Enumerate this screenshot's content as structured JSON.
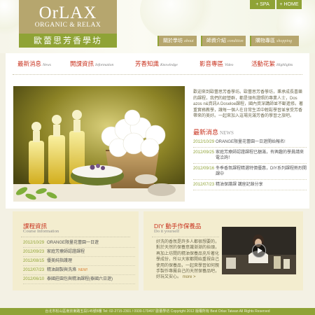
{
  "brand": {
    "logo_text": "OrLAX",
    "tagline": "ORGANIC & RELAX",
    "chinese_name": "歐蕾思芳香學坊"
  },
  "top_links": [
    {
      "label": "+ SPA"
    },
    {
      "label": "+ HOME"
    }
  ],
  "nav": [
    {
      "label": "關於學坊",
      "en": "about"
    },
    {
      "label": "師資介紹",
      "en": "condition"
    },
    {
      "label": "購物專區",
      "en": "shopping"
    }
  ],
  "tabs": [
    {
      "label": "最新消息",
      "en": "News"
    },
    {
      "label": "開課資訊",
      "en": "Information"
    },
    {
      "label": "芳香知識",
      "en": "Knowledge"
    },
    {
      "label": "影音專區",
      "en": "Video"
    },
    {
      "label": "活動花絮",
      "en": "Highlights"
    }
  ],
  "intro": "歡迎來到歐蕾思芳香學坊。歐蕾思芳香學坊，秉承成長喜樂的課程，我們的經營群，都是領有證照的專業人士，Dos azos n&資訊A Doseloe課程，國內資深講師並不斷進修。著重實務教學，讓每一個人在日常生活中輕鬆學習並享受芳香帶來的美好。一起來加入這場充滿芳香的學習之旅吧。",
  "news": {
    "title": "最新消息",
    "title_en": "NEWS",
    "items": [
      {
        "date": "2012/10/29",
        "text": "ORANGE限量花蕾園一日遊開始報名!"
      },
      {
        "date": "2012/09/25",
        "text": "家庭芳療師認證課程已額滿，有興趣的學員請來電洽詢！"
      },
      {
        "date": "2012/09/16",
        "text": "冬季香氛課程精選特價優惠，DIY系列課程熱烈開課中"
      },
      {
        "date": "2012/07/23",
        "text": "精油保護課 講座記錄分享"
      }
    ]
  },
  "course": {
    "title": "課程資訊",
    "title_en": "Course Information",
    "items": [
      {
        "date": "2012/10/29",
        "text": "ORANGE限量花蕾園一日遊",
        "badge": ""
      },
      {
        "date": "2012/09/23",
        "text": "家庭芳療師認證課程",
        "badge": ""
      },
      {
        "date": "2012/08/15",
        "text": "優美純指護理",
        "badge": ""
      },
      {
        "date": "2012/07/23",
        "text": "精油調製與洗滌",
        "badge": "NEW!"
      },
      {
        "date": "2012/06/10",
        "text": "泰國莊園包與精油課程(泰國六日遊)",
        "badge": ""
      }
    ]
  },
  "diy": {
    "title": "DIY 動手作保養品",
    "title_en": "Do it yourself",
    "text": "好洗的香氛是許多人都很想要的，對於天然的保養意識漸漸的抬頭，再加上坊間的精油保養品充斥著化學成份，所以大家都開始重視自己使用的保養品，一起來學習如何親手製作專屬自己的天然保養品吧，好玩又安心。",
    "more": "more >"
  },
  "footer": {
    "text": "台北市松山區南京東路五段145號8樓 Tel: 02-2715-2301 / 0930-170497 歐蕾學坊 Copyright 2012 版權所有 Best Orlax Taiwan All Rights Reserved"
  },
  "colors": {
    "olive": "#8fa336",
    "khaki": "#b6a66e",
    "red": "#c8321e",
    "cream": "#f3edcf"
  }
}
